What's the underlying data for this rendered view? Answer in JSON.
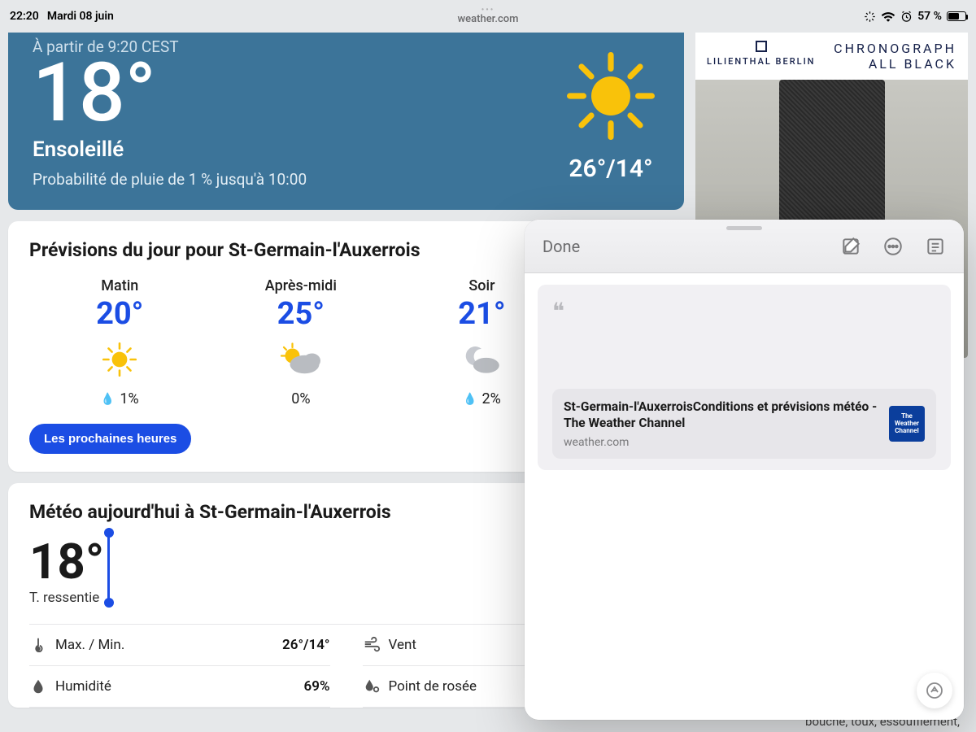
{
  "status": {
    "time": "22:20",
    "date": "Mardi 08 juin",
    "site": "weather.com",
    "battery_pct": "57 %"
  },
  "hero": {
    "asof": "À partir de 9:20 CEST",
    "temp": "18°",
    "condition": "Ensoleillé",
    "precip_line": "Probabilité de pluie de 1 % jusqu'à 10:00",
    "hilo": "26°/14°"
  },
  "forecast": {
    "title": "Prévisions du jour pour St-Germain-l'Auxerrois",
    "parts": [
      {
        "label": "Matin",
        "temp": "20°",
        "precip": "1%",
        "icon": "sun"
      },
      {
        "label": "Après-midi",
        "temp": "25°",
        "precip": "0%",
        "icon": "partly"
      },
      {
        "label": "Soir",
        "temp": "21°",
        "precip": "2%",
        "icon": "moon-cloud"
      }
    ],
    "button": "Les prochaines heures"
  },
  "today": {
    "title": "Météo aujourd'hui à St-Germain-l'Auxerrois",
    "feels_temp": "18°",
    "feels_label": "T. ressentie",
    "rows_left": [
      {
        "icon": "thermo",
        "label": "Max. / Min.",
        "value": "26°/14°"
      },
      {
        "icon": "drop",
        "label": "Humidité",
        "value": "69%"
      }
    ],
    "rows_right": [
      {
        "icon": "wind",
        "label": "Vent",
        "value": ""
      },
      {
        "icon": "dew",
        "label": "Point de rosée",
        "value": ""
      }
    ]
  },
  "ad": {
    "brand": "LILIENTHAL BERLIN",
    "product_l1": "CHRONOGRAPH",
    "product_l2": "ALL BLACK"
  },
  "right_cut_text": "bouché, toux, essoufflement,",
  "notes": {
    "done": "Done",
    "link_title": "St-Germain-l'AuxerroisConditions et prévisions météo - The Weather Channel",
    "link_domain": "weather.com",
    "thumb_text": "The Weather Channel"
  }
}
